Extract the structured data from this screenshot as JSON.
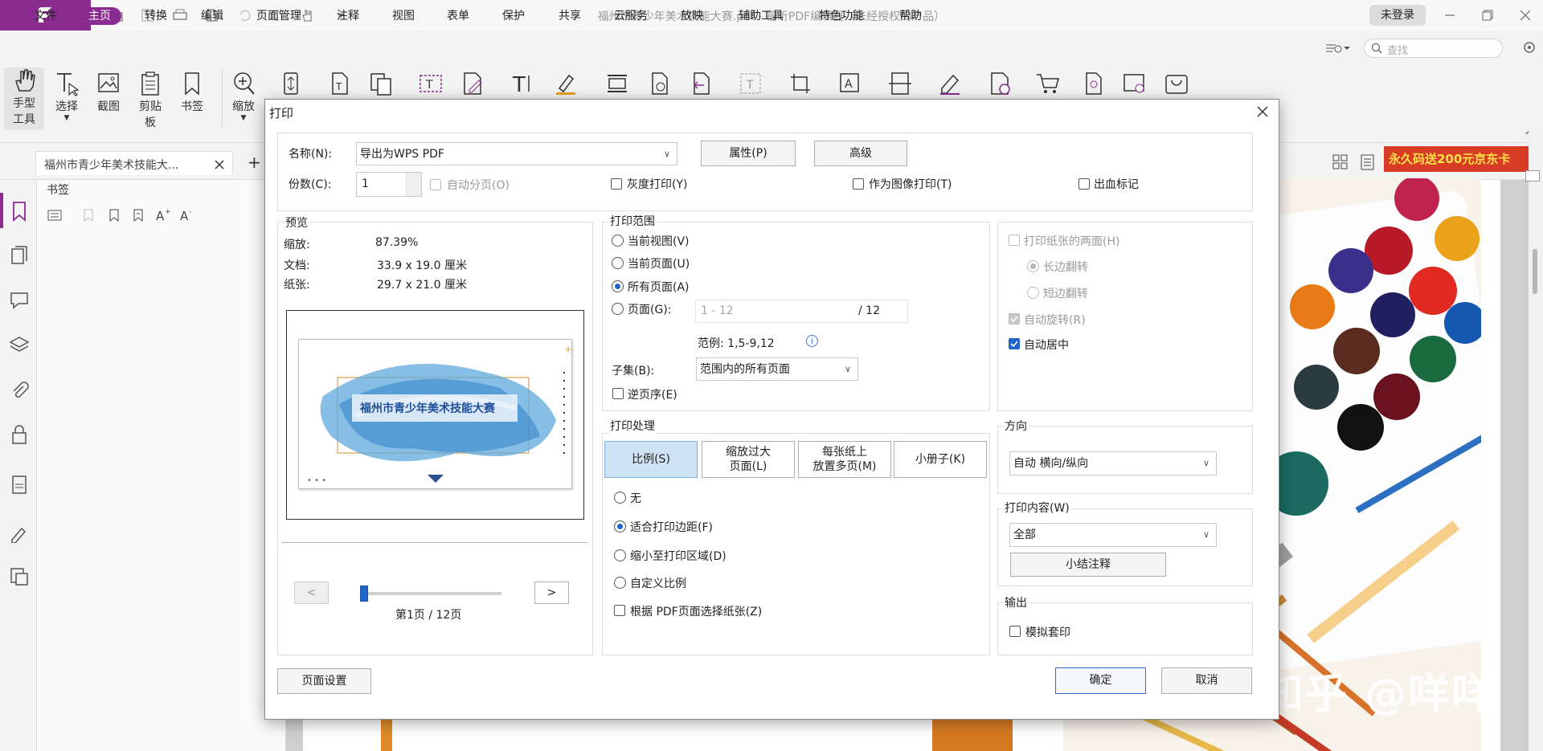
{
  "app": {
    "title": "福州市青少年美术技能大赛.pdf - 福昕PDF编辑器（未经授权的产品）",
    "login": "未登录"
  },
  "menu": [
    "文件",
    "主页",
    "转换",
    "编辑",
    "页面管理",
    "注释",
    "视图",
    "表单",
    "保护",
    "共享",
    "云服务",
    "放映",
    "辅助工具",
    "特色功能",
    "帮助"
  ],
  "search": {
    "placeholder": "查找"
  },
  "toolbar": {
    "hand_line1": "手型",
    "hand_line2": "工具",
    "select": "选择",
    "screenshot": "截图",
    "clipboard_line1": "剪贴",
    "clipboard_line2": "板",
    "bookmark": "书签",
    "zoom": "缩放"
  },
  "tab": {
    "title": "福州市青少年美术技能大..."
  },
  "promo": "永久码送200元京东卡",
  "panel": {
    "title": "书签"
  },
  "watermark": "知乎 @咩咩",
  "dialog": {
    "title": "打印",
    "name_label": "名称(N):",
    "printer": "导出为WPS PDF",
    "properties": "属性(P)",
    "advanced": "高级",
    "copies_label": "份数(C):",
    "copies": "1",
    "collate": "自动分页(O)",
    "grayscale": "灰度打印(Y)",
    "as_image": "作为图像打印(T)",
    "bleed": "出血标记",
    "preview": {
      "header": "预览",
      "zoom_label": "缩放:",
      "zoom": "87.39%",
      "doc_label": "文档:",
      "doc": "33.9 x 19.0 厘米",
      "paper_label": "纸张:",
      "paper": "29.7 x 21.0 厘米",
      "thumb_title": "福州市青少年美术技能大赛",
      "prev": "<",
      "next": ">",
      "page_info": "第1页 / 12页",
      "slider_fraction": 0.0
    },
    "range": {
      "header": "打印范围",
      "current_view": "当前视图(V)",
      "current_page": "当前页面(U)",
      "all_pages": "所有页面(A)",
      "pages": "页面(G):",
      "pages_placeholder": "1 - 12",
      "pages_total": "/ 12",
      "example": "范例: 1,5-9,12",
      "subset_label": "子集(B):",
      "subset": "范围内的所有页面",
      "reverse": "逆页序(E)"
    },
    "handling": {
      "header": "打印处理",
      "tab_scale": "比例(S)",
      "tab_fit_line1": "缩放过大",
      "tab_fit_line2": "页面(L)",
      "tab_multi_line1": "每张纸上",
      "tab_multi_line2": "放置多页(M)",
      "tab_booklet": "小册子(K)",
      "none": "无",
      "fit_margins": "适合打印边距(F)",
      "shrink": "缩小至打印区域(D)",
      "custom": "自定义比例",
      "by_pdf": "根据 PDF页面选择纸张(Z)"
    },
    "duplex": {
      "both_sides": "打印纸张的两面(H)",
      "long_edge": "长边翻转",
      "short_edge": "短边翻转",
      "auto_rotate": "自动旋转(R)",
      "auto_center": "自动居中"
    },
    "orientation": {
      "header": "方向",
      "value": "自动 横向/纵向"
    },
    "content": {
      "header": "打印内容(W)",
      "value": "全部",
      "summary": "小结注释"
    },
    "output": {
      "header": "输出",
      "simulate": "模拟套印"
    },
    "page_setup": "页面设置",
    "ok": "确定",
    "cancel": "取消"
  },
  "colors": {
    "brand": "#8a2b8f",
    "accent": "#1f66c9",
    "promo": "#d83c24"
  }
}
